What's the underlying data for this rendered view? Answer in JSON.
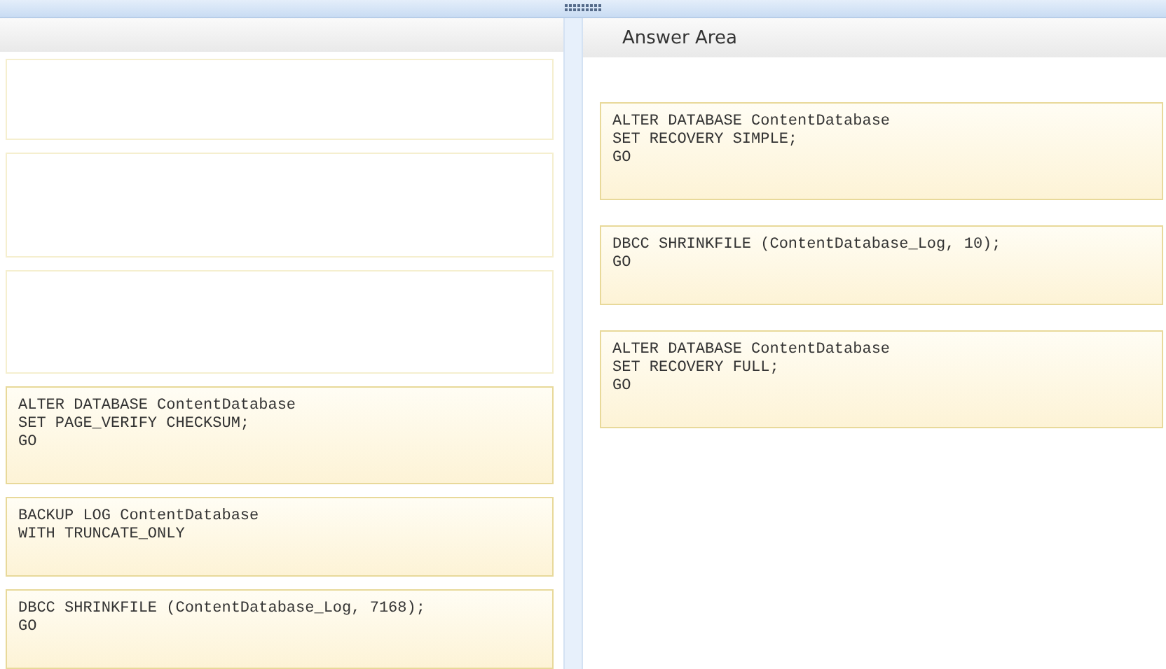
{
  "left": {
    "slots": [
      {
        "kind": "empty"
      },
      {
        "kind": "empty"
      },
      {
        "kind": "empty"
      },
      {
        "kind": "code",
        "code": "ALTER DATABASE ContentDatabase\nSET PAGE_VERIFY CHECKSUM;\nGO"
      },
      {
        "kind": "code",
        "code": "BACKUP LOG ContentDatabase\nWITH TRUNCATE_ONLY"
      },
      {
        "kind": "code",
        "code": "DBCC SHRINKFILE (ContentDatabase_Log, 7168);\nGO"
      }
    ]
  },
  "answer_area": {
    "title": "Answer Area",
    "slots": [
      {
        "kind": "code",
        "code": "ALTER DATABASE ContentDatabase\nSET RECOVERY SIMPLE;\nGO"
      },
      {
        "kind": "code",
        "code": "DBCC SHRINKFILE (ContentDatabase_Log, 10);\nGO"
      },
      {
        "kind": "code",
        "code": "ALTER DATABASE ContentDatabase\nSET RECOVERY FULL;\nGO"
      }
    ]
  }
}
